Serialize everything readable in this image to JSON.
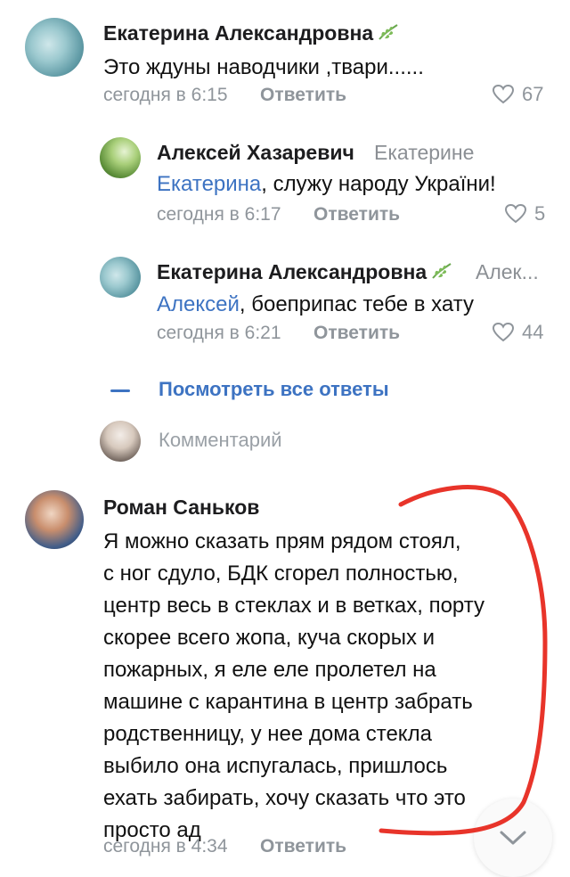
{
  "comments": [
    {
      "author": "Екатерина Александровна",
      "text": "Это ждуны наводчики ,твари......",
      "time": "сегодня в 6:15",
      "reply_label": "Ответить",
      "likes": "67"
    },
    {
      "author": "Алексей Хазаревич",
      "reply_to": "Екатерине",
      "mention": "Екатерина",
      "text": ", служу народу України!",
      "time": "сегодня в 6:17",
      "reply_label": "Ответить",
      "likes": "5"
    },
    {
      "author": "Екатерина Александровна",
      "reply_to": "Алек...",
      "mention": "Алексей",
      "text": ", боеприпас тебе в хату",
      "time": "сегодня в 6:21",
      "reply_label": "Ответить",
      "likes": "44"
    },
    {
      "author": "Роман Саньков",
      "lines": [
        "Я можно сказать прям рядом стоял,",
        "с ног сдуло, БДК сгорел полностью,",
        "центр весь в стеклах и в ветках, порту",
        "скорее всего жопа, куча скорых и",
        "пожарных, я еле еле пролетел на",
        "машине с карантина в центр забрать",
        "родственницу, у нее дома стекла",
        "выбило она испугалась, пришлось",
        "ехать забирать, хочу сказать что это",
        "просто ад"
      ],
      "time": "сегодня в 4:34",
      "reply_label": "Ответить"
    }
  ],
  "thread": {
    "show_all_label": "Посмотреть все ответы",
    "comment_placeholder": "Комментарий"
  },
  "colors": {
    "accent": "#3d73c2",
    "muted": "#8f959b",
    "annotation": "#e8342a"
  },
  "icons": [
    "heart-icon",
    "leaf-icon",
    "chevron-down-icon"
  ]
}
